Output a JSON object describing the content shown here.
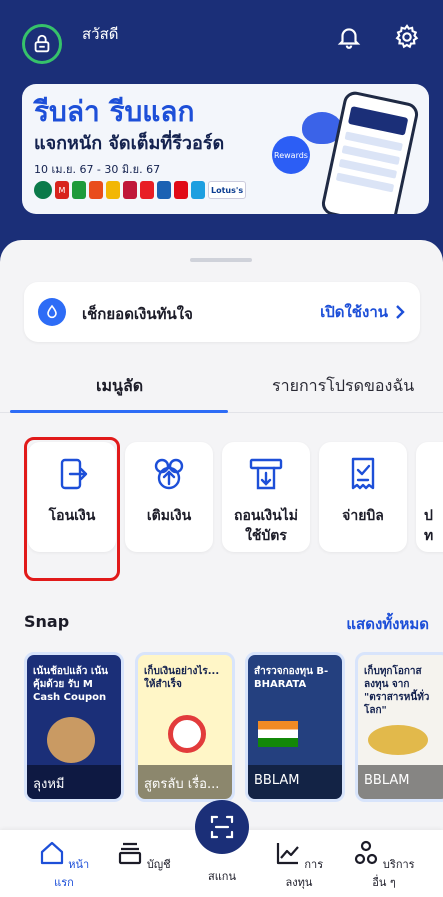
{
  "header": {
    "greeting": "สวัสดี"
  },
  "banner": {
    "title": "รีบล่า รีบแลก",
    "subtitle": "แจกหนัก จัดเต็มที่รีวอร์ด",
    "dates": "10 เม.ย. 67 - 30 มิ.ย. 67",
    "badge": "Rewards",
    "partner_logo_text": "Lotus's"
  },
  "balance": {
    "label": "เช็กยอดเงินทันใจ",
    "action": "เปิดใช้งาน"
  },
  "tabs": [
    {
      "label": "เมนูลัด"
    },
    {
      "label": "รายการโปรดของฉัน"
    }
  ],
  "menu": [
    {
      "label": "โอนเงิน",
      "icon": "transfer-icon"
    },
    {
      "label": "เติมเงิน",
      "icon": "topup-icon"
    },
    {
      "label": "ถอนเงินไม่ใช้บัตร",
      "icon": "cardless-withdraw-icon"
    },
    {
      "label": "จ่ายบิล",
      "icon": "bill-icon"
    },
    {
      "label": "ป\nท",
      "icon": "partial-icon"
    }
  ],
  "snap": {
    "title": "Snap",
    "see_all": "แสดงทั้งหมด",
    "cards": [
      {
        "caption": "ลุงหมี",
        "headline": "เน้นช้อปแล้ว เน้นคุ้มด้วย รับ M Cash Coupon",
        "color": "#1b2f78"
      },
      {
        "caption": "สูตรลับ เรื่อ...",
        "headline": "เก็บเงินอย่างไร... ให้สำเร็จ",
        "color": "#fff6c7"
      },
      {
        "caption": "BBLAM",
        "headline": "สำรวจกองทุน B-BHARATA",
        "color": "#24407f"
      },
      {
        "caption": "BBLAM",
        "headline": "เก็บทุกโอกาสลงทุน จาก \"ตราสารหนี้ทั่วโลก\"",
        "color": "#f5f3ee"
      }
    ]
  },
  "nav": {
    "home": "หน้าแรก",
    "accounts": "บัญชี",
    "scan": "สแกน",
    "invest": "การลงทุน",
    "more": "บริการอื่น ๆ"
  },
  "colors": {
    "brand": "#1b2f78",
    "accent": "#1d4fd8",
    "highlight": "#e11a1a",
    "avatar_ring": "#36c26a"
  }
}
